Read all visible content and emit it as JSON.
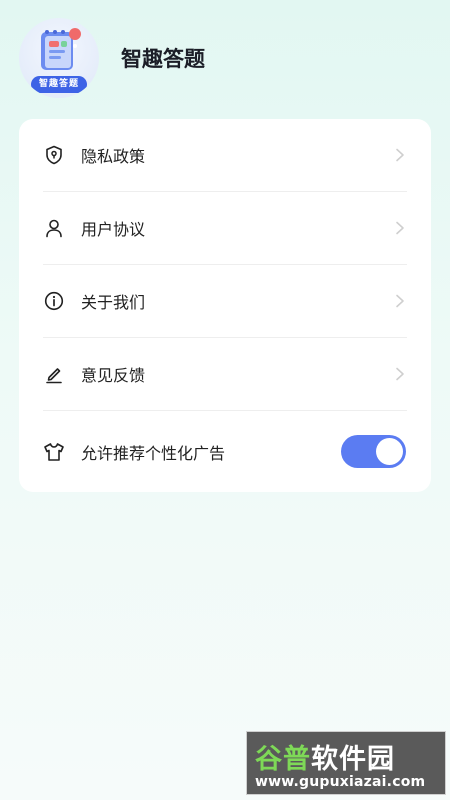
{
  "header": {
    "app_name": "智趣答题",
    "avatar_label": "智趣答题"
  },
  "menu": {
    "items": [
      {
        "label": "隐私政策",
        "icon": "shield-icon"
      },
      {
        "label": "用户协议",
        "icon": "user-icon"
      },
      {
        "label": "关于我们",
        "icon": "info-icon"
      },
      {
        "label": "意见反馈",
        "icon": "edit-icon"
      }
    ],
    "ad_toggle": {
      "label": "允许推荐个性化广告",
      "icon": "shirt-icon",
      "enabled": true
    }
  },
  "colors": {
    "accent": "#5b7cf2",
    "badge": "#3d63e6"
  },
  "watermark": {
    "title_a": "谷普",
    "title_b": "软件园",
    "url": "www.gupuxiazai.com"
  }
}
